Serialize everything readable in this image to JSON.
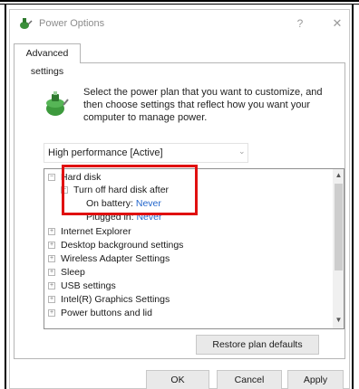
{
  "window": {
    "title": "Power Options",
    "help_glyph": "?",
    "close_glyph": "✕"
  },
  "tab": {
    "label": "Advanced settings"
  },
  "description": "Select the power plan that you want to customize, and then choose settings that reflect how you want your computer to manage power.",
  "plan": {
    "selected": "High performance [Active]"
  },
  "tree": {
    "hard_disk": "Hard disk",
    "turn_off_after": "Turn off hard disk after",
    "on_battery_label": "On battery:",
    "on_battery_value": "Never",
    "plugged_in_label": "Plugged in:",
    "plugged_in_value": "Never",
    "items": [
      "Internet Explorer",
      "Desktop background settings",
      "Wireless Adapter Settings",
      "Sleep",
      "USB settings",
      "Intel(R) Graphics Settings",
      "Power buttons and lid"
    ]
  },
  "buttons": {
    "restore": "Restore plan defaults",
    "ok": "OK",
    "cancel": "Cancel",
    "apply": "Apply"
  },
  "colors": {
    "highlight": "#e01010",
    "link": "#2266cc"
  }
}
